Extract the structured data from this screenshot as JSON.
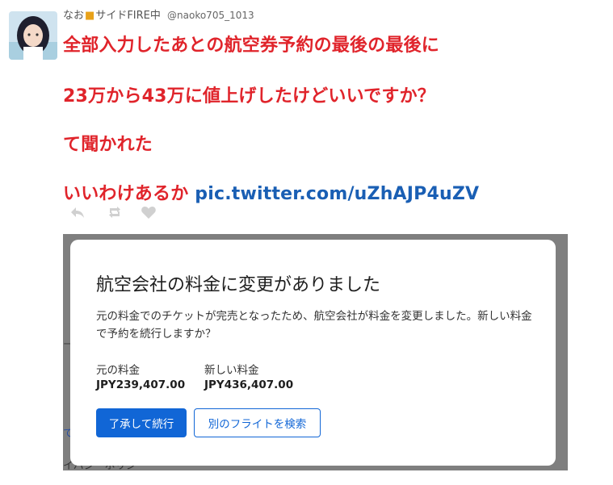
{
  "user": {
    "name_prefix": "なお",
    "name_suffix": "サイドFIRE中",
    "handle": "@naoko705_1013"
  },
  "tweet": {
    "line1": "全部入力したあとの航空券予約の最後の最後に",
    "line2": "23万から43万に値上げしたけどいいですか？",
    "line3": "て聞かれた",
    "line4_text": "いいわけあるか",
    "line4_link": "pic.twitter.com/uZhAJP4uZV"
  },
  "actions": {
    "reply_icon": "reply-icon",
    "retweet_icon": "retweet-icon",
    "like_icon": "heart-icon"
  },
  "dialog": {
    "title": "航空会社の料金に変更がありました",
    "body": "元の料金でのチケットが完売となったため、航空会社が料金を変更しました。新しい料金で予約を続行しますか？",
    "old_fare_label": "元の料金",
    "old_fare_value": "JPY239,407.00",
    "new_fare_label": "新しい料金",
    "new_fare_value": "JPY436,407.00",
    "accept_button": "了承して続行",
    "search_button": "別のフライトを検索"
  },
  "colors": {
    "tweet_text": "#e0242b",
    "link": "#1a5fb4",
    "primary_button": "#1166d6",
    "overlay": "#7f7f7f"
  }
}
